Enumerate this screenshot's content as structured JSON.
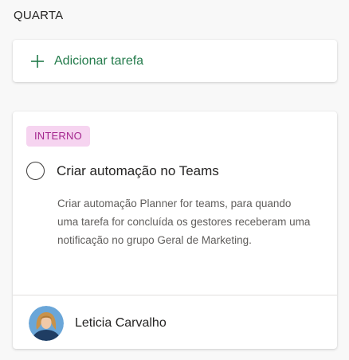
{
  "column": {
    "title": "QUARTA"
  },
  "add_task": {
    "icon": "plus-icon",
    "label": "Adicionar tarefa",
    "accent_color": "#237b4b"
  },
  "task": {
    "label_badge": "INTERNO",
    "label_colors": {
      "background": "#f6d4f0",
      "text": "#a4268e"
    },
    "title": "Criar automação no Teams",
    "description": "Criar automação Planner for teams, para quando uma tarefa for concluída os gestores receberam uma notificação no grupo Geral de Marketing.",
    "assignee": {
      "name": "Leticia Carvalho",
      "avatar": "avatar"
    },
    "completed": false
  }
}
